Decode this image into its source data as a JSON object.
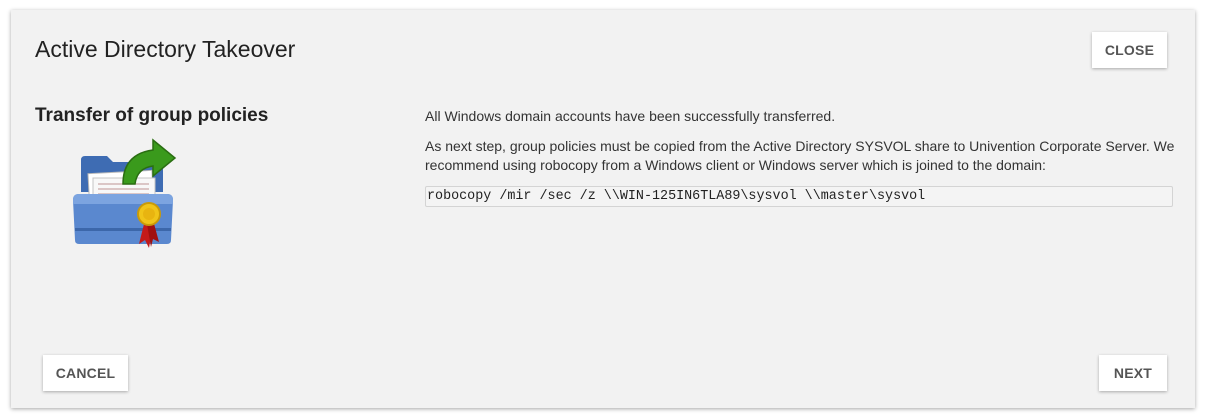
{
  "dialog": {
    "title": "Active Directory Takeover",
    "close_label": "CLOSE",
    "cancel_label": "CANCEL",
    "next_label": "NEXT"
  },
  "step": {
    "heading": "Transfer of group policies",
    "icon": "folder-transfer-certificate-icon",
    "paragraph1": "All Windows domain accounts have been successfully transferred.",
    "paragraph2": "As next step, group policies must be copied from the Active Directory SYSVOL share to Univention Corporate Server. We recommend using robocopy from a Windows client or Windows server which is joined to the domain:",
    "command": "robocopy /mir /sec /z \\\\WIN-125IN6TLA89\\sysvol \\\\master\\sysvol"
  },
  "colors": {
    "dialog_bg": "#f2f2f2",
    "button_bg": "#ffffff",
    "button_text": "#555555",
    "arrow_green": "#3a9a1c",
    "folder_blue": "#4a78c0"
  }
}
